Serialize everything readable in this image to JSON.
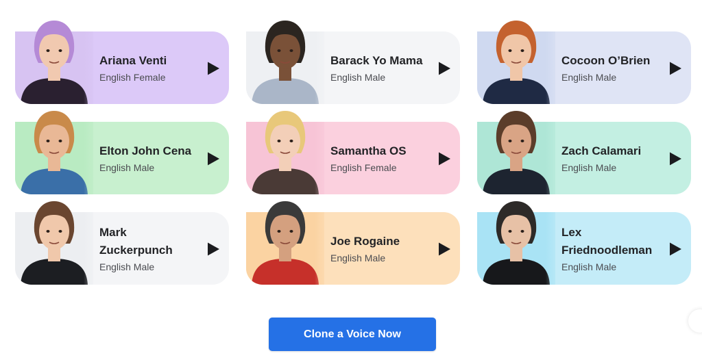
{
  "voices": [
    {
      "name": "Ariana Venti",
      "lang": "English Female",
      "bg": "#dcc9f8",
      "skin": "#f1c9b0",
      "hair": "#b58ad6",
      "shirt": "#2a2030",
      "portrait_bg": "#d7c3f2",
      "play_icon": "play-icon"
    },
    {
      "name": "Barack Yo Mama",
      "lang": "English Male",
      "bg": "#f4f5f7",
      "skin": "#7a5138",
      "hair": "#2b2520",
      "shirt": "#aab6c8",
      "portrait_bg": "#eef0f3",
      "play_icon": "play-icon"
    },
    {
      "name": "Cocoon O’Brien",
      "lang": "English Male",
      "bg": "#dfe4f5",
      "skin": "#f0c6a8",
      "hair": "#c4622f",
      "shirt": "#1f2a44",
      "portrait_bg": "#cfd9f0",
      "play_icon": "play-icon"
    },
    {
      "name": "Elton John Cena",
      "lang": "English Male",
      "bg": "#c8f0cf",
      "skin": "#e9b896",
      "hair": "#c98a4a",
      "shirt": "#3a6fa8",
      "portrait_bg": "#b9ebc2",
      "play_icon": "play-icon"
    },
    {
      "name": "Samantha OS",
      "lang": "English Female",
      "bg": "#fbd0de",
      "skin": "#f3cfb8",
      "hair": "#e8c87a",
      "shirt": "#4a3a36",
      "portrait_bg": "#f7c4d6",
      "play_icon": "play-icon"
    },
    {
      "name": "Zach Calamari",
      "lang": "English Male",
      "bg": "#c3efe2",
      "skin": "#d9a485",
      "hair": "#5b3d2a",
      "shirt": "#1d2430",
      "portrait_bg": "#aee6d6",
      "play_icon": "play-icon"
    },
    {
      "name": "Mark Zuckerpunch",
      "lang": "English Male",
      "bg": "#f4f5f7",
      "skin": "#f0c8ab",
      "hair": "#6a4630",
      "shirt": "#1c1e22",
      "portrait_bg": "#eceef1",
      "play_icon": "play-icon"
    },
    {
      "name": "Joe Rogaine",
      "lang": "English Male",
      "bg": "#fde0bb",
      "skin": "#d4a07f",
      "hair": "#3a3a3a",
      "shirt": "#c6302a",
      "portrait_bg": "#fbd3a2",
      "play_icon": "play-icon"
    },
    {
      "name": "Lex Friednoodleman",
      "lang": "English Male",
      "bg": "#c4ecf8",
      "skin": "#e7c1a6",
      "hair": "#2d2a28",
      "shirt": "#17181b",
      "portrait_bg": "#a9e3f5",
      "play_icon": "play-icon"
    }
  ],
  "cta": {
    "label": "Clone a Voice Now",
    "color": "#2571e6"
  },
  "colors": {
    "play": "#1b1c1f",
    "name_text": "#222326",
    "sub_text": "#4a4b50"
  }
}
